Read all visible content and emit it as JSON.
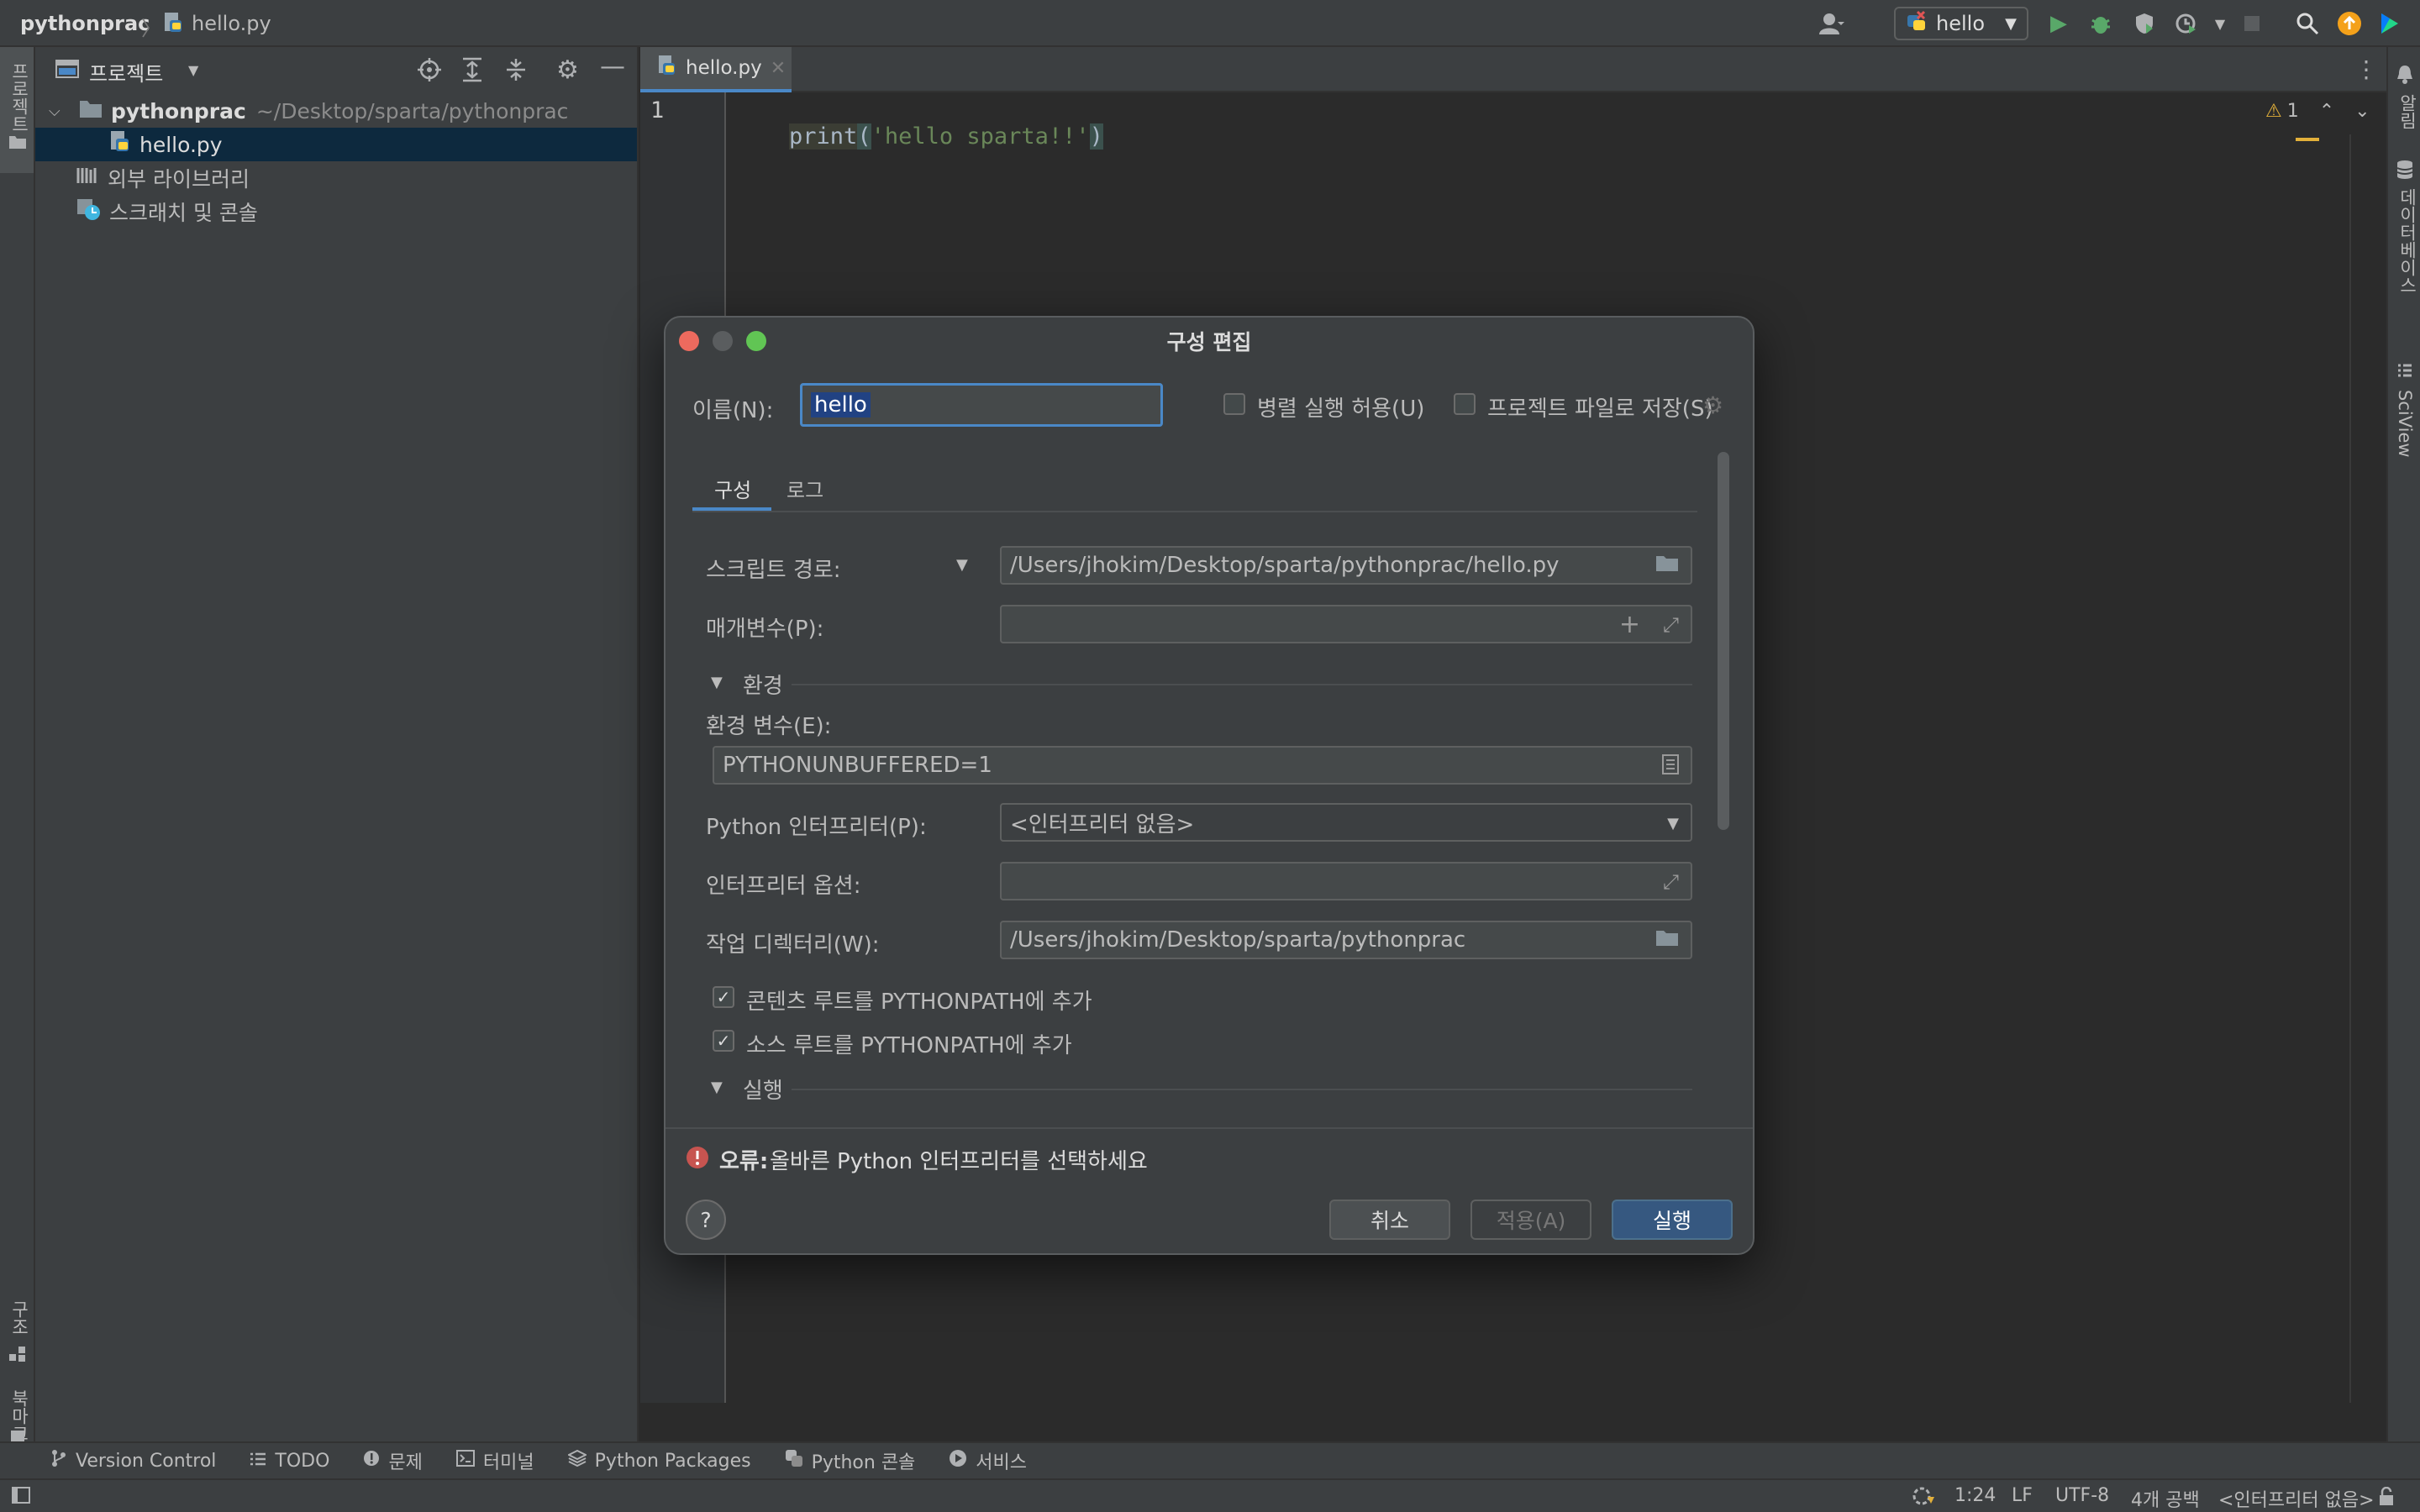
{
  "topbar": {
    "project_crumb": "pythonprac",
    "file_crumb": "hello.py",
    "run_config": "hello"
  },
  "left_strip": {
    "project_label": "프로젝트",
    "structure_label": "구조",
    "bookmarks_label": "북마크"
  },
  "right_strip": {
    "notifications_label": "알림",
    "database_label": "데이터베이스",
    "sciview_label": "SciView"
  },
  "project_panel": {
    "title": "프로젝트",
    "tree": {
      "root_name": "pythonprac",
      "root_path": "~/Desktop/sparta/pythonprac",
      "file": "hello.py",
      "external_libs": "외부 라이브러리",
      "scratches": "스크래치 및 콘솔"
    }
  },
  "editor": {
    "tab_label": "hello.py",
    "line_number": "1",
    "code_fn": "print",
    "code_open": "(",
    "code_string": "'hello sparta!!'",
    "code_close": ")",
    "warning_count": "1"
  },
  "dialog": {
    "title": "구성 편집",
    "name_label": "이름(N):",
    "name_value": "hello",
    "parallel_label": "병렬 실행 허용(U)",
    "save_project_label": "프로젝트 파일로 저장(S)",
    "tabs": [
      "구성",
      "로그"
    ],
    "script_path_label": "스크립트 경로:",
    "script_path_value": "/Users/jhokim/Desktop/sparta/pythonprac/hello.py",
    "params_label": "매개변수(P):",
    "params_value": "",
    "env_section": "환경",
    "env_vars_label": "환경 변수(E):",
    "env_vars_value": "PYTHONUNBUFFERED=1",
    "interpreter_label": "Python 인터프리터(P):",
    "interpreter_value": "<인터프리터 없음>",
    "interp_options_label": "인터프리터 옵션:",
    "interp_options_value": "",
    "workdir_label": "작업 디렉터리(W):",
    "workdir_value": "/Users/jhokim/Desktop/sparta/pythonprac",
    "content_roots_label": "콘텐츠 루트를 PYTHONPATH에 추가",
    "source_roots_label": "소스 루트를 PYTHONPATH에 추가",
    "exec_section": "실행",
    "error_prefix": "오류:",
    "error_text": "올바른 Python 인터프리터를 선택하세요",
    "help_label": "?",
    "cancel_label": "취소",
    "apply_label": "적용(A)",
    "run_label": "실행"
  },
  "bottom_tools": [
    "Version Control",
    "TODO",
    "문제",
    "터미널",
    "Python Packages",
    "Python 콘솔",
    "서비스"
  ],
  "statusbar": {
    "position": "1:24",
    "line_sep": "LF",
    "encoding": "UTF-8",
    "indent": "4개 공백",
    "interpreter": "<인터프리터 없음>"
  },
  "colors": {
    "accent": "#4a88c7",
    "error_red": "#c75450",
    "run_green": "#59a869",
    "warning_yellow": "#e2b03a"
  }
}
